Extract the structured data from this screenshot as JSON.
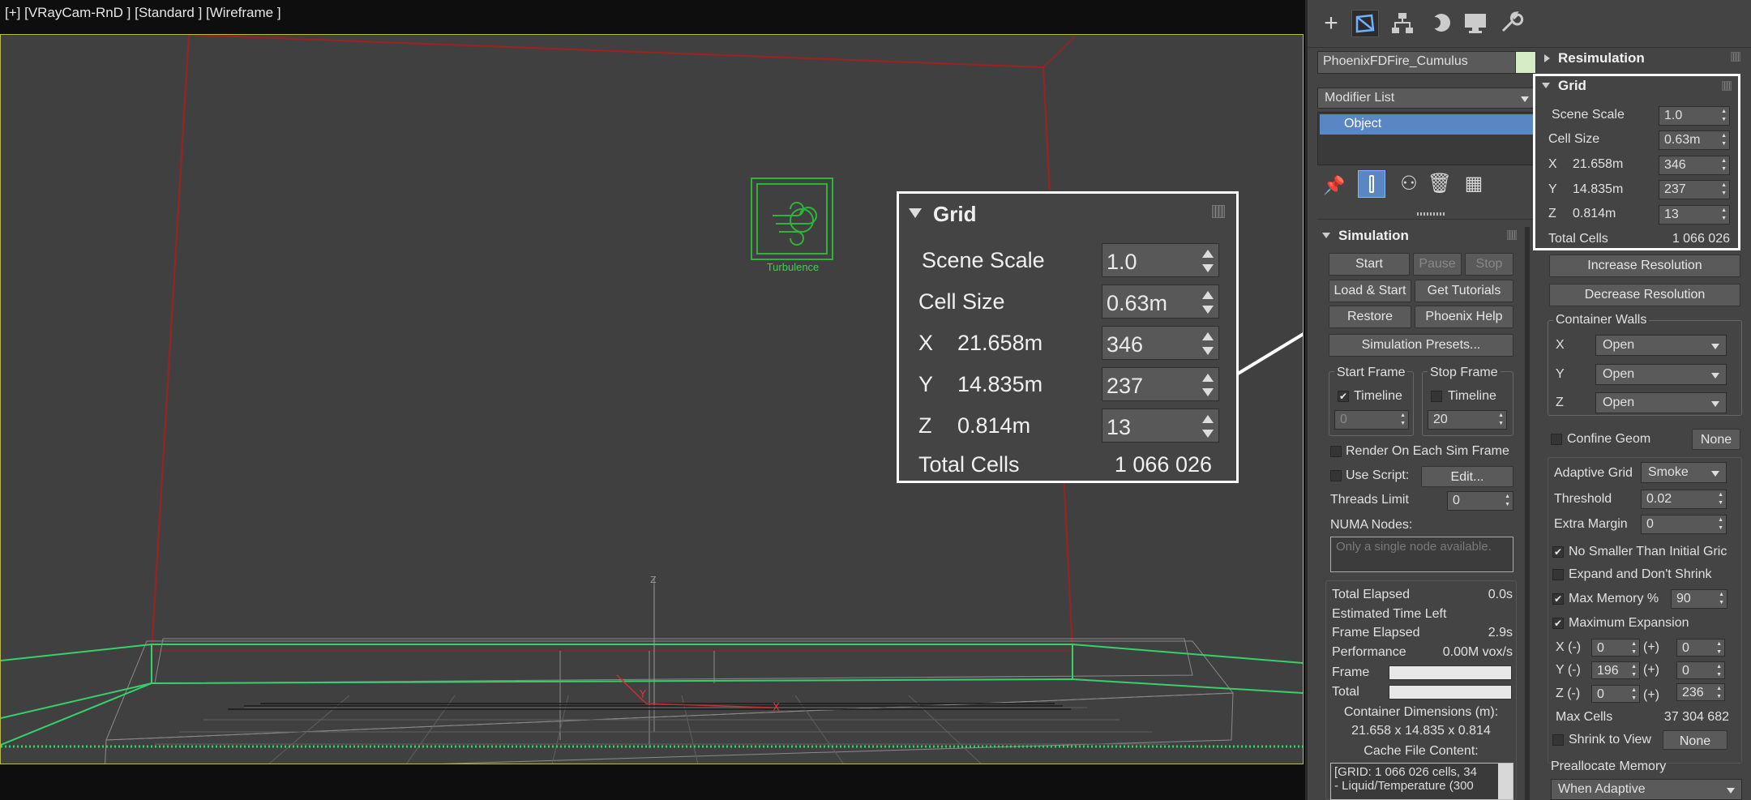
{
  "viewport": {
    "label": "[+] [VRayCam-RnD ] [Standard ] [Wireframe ]",
    "turbulence_label": "Turbulence",
    "axis_z": "Z",
    "axis_x": "X",
    "axis_y": "Y"
  },
  "callout": {
    "title": "Grid",
    "scene_scale_label": "Scene Scale",
    "scene_scale": "1.0",
    "cell_size_label": "Cell Size",
    "cell_size": "0.63m",
    "x_label": "X",
    "x_size": "21.658m",
    "x_cells": "346",
    "y_label": "Y",
    "y_size": "14.835m",
    "y_cells": "237",
    "z_label": "Z",
    "z_size": "0.814m",
    "z_cells": "13",
    "total_label": "Total Cells",
    "total": "1 066 026"
  },
  "panel": {
    "object_name": "PhoenixFDFire_Cumulus",
    "modifier_list": "Modifier List",
    "stack_item": "Object",
    "simulation": {
      "title": "Simulation",
      "start": "Start",
      "pause": "Pause",
      "stop": "Stop",
      "load_start": "Load & Start",
      "get_tutorials": "Get Tutorials",
      "restore": "Restore",
      "phoenix_help": "Phoenix Help",
      "presets": "Simulation Presets...",
      "start_frame": "Start Frame",
      "stop_frame": "Stop Frame",
      "timeline": "Timeline",
      "start_value": "0",
      "stop_value": "20",
      "render_each": "Render On Each Sim Frame",
      "use_script": "Use Script:",
      "edit": "Edit...",
      "threads_limit": "Threads Limit",
      "threads_value": "0",
      "numa_nodes": "NUMA Nodes:",
      "numa_placeholder": "Only a single node available.",
      "total_elapsed_label": "Total Elapsed",
      "total_elapsed": "0.0s",
      "est_time_left": "Estimated Time Left",
      "frame_elapsed_label": "Frame Elapsed",
      "frame_elapsed": "2.9s",
      "performance_label": "Performance",
      "performance": "0.00M vox/s",
      "frame_label": "Frame",
      "total_label": "Total",
      "container_dims_label": "Container Dimensions (m):",
      "container_dims": "21.658 x 14.835 x 0.814",
      "cache_label": "Cache File Content:",
      "cache_line1": "[GRID: 1 066 026 cells, 34",
      "cache_line2": "- Liquid/Temperature (300"
    },
    "resimulation": "Resimulation",
    "grid": {
      "title": "Grid",
      "scene_scale_label": "Scene Scale",
      "scene_scale": "1.0",
      "cell_size_label": "Cell Size",
      "cell_size": "0.63m",
      "x_label": "X",
      "x_size": "21.658m",
      "x_cells": "346",
      "y_label": "Y",
      "y_size": "14.835m",
      "y_cells": "237",
      "z_label": "Z",
      "z_size": "0.814m",
      "z_cells": "13",
      "total_label": "Total Cells",
      "total": "1 066 026",
      "increase_res": "Increase Resolution",
      "decrease_res": "Decrease Resolution",
      "container_walls": "Container Walls",
      "wall_x": "Open",
      "wall_y": "Open",
      "wall_z": "Open",
      "confine_geom": "Confine Geom",
      "confine_none": "None",
      "adaptive_grid": "Adaptive Grid",
      "adaptive_value": "Smoke",
      "threshold_label": "Threshold",
      "threshold": "0.02",
      "extra_margin_label": "Extra Margin",
      "extra_margin": "0",
      "no_smaller": "No Smaller Than Initial Gric",
      "expand_dont_shrink": "Expand and Don't Shrink",
      "max_memory_label": "Max Memory %",
      "max_memory": "90",
      "max_expansion": "Maximum Expansion",
      "xm_label": "X (-)",
      "xm": "0",
      "xp_label": "(+)",
      "xp": "0",
      "ym_label": "Y (-)",
      "ym": "196",
      "yp_label": "(+)",
      "yp": "0",
      "zm_label": "Z (-)",
      "zm": "0",
      "zp_label": "(+)",
      "zp": "236",
      "max_cells_label": "Max Cells",
      "max_cells": "37 304 682",
      "shrink_to_view": "Shrink to View",
      "shrink_none": "None",
      "prealloc_label": "Preallocate Memory",
      "prealloc_value": "When Adaptive"
    }
  }
}
